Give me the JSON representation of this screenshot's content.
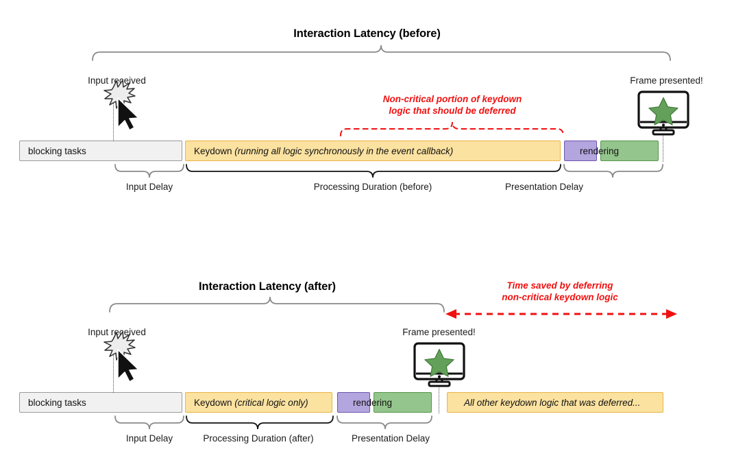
{
  "sections": [
    {
      "id": "before",
      "title": "Interaction Latency (before)",
      "input_label": "Input received",
      "frame_label": "Frame presented!",
      "annotation": {
        "line1": "Non-critical portion of keydown",
        "line2": "logic that should be deferred"
      },
      "bars": [
        {
          "name": "blocking-tasks",
          "label": "blocking tasks",
          "label_italic": ""
        },
        {
          "name": "keydown",
          "label": "Keydown ",
          "label_italic": "(running all logic synchronously in the event callback)"
        },
        {
          "name": "purple-render",
          "label": "",
          "label_italic": ""
        },
        {
          "name": "green-render",
          "label": "",
          "label_italic": ""
        }
      ],
      "rendering_label": "rendering",
      "braces": [
        {
          "name": "input-delay",
          "label": "Input Delay"
        },
        {
          "name": "processing-duration",
          "label": "Processing Duration (before)"
        },
        {
          "name": "presentation-delay",
          "label": "Presentation Delay"
        }
      ]
    },
    {
      "id": "after",
      "title": "Interaction Latency (after)",
      "input_label": "Input received",
      "frame_label": "Frame presented!",
      "annotation": {
        "line1": "Time saved by deferring",
        "line2": "non-critical keydown logic"
      },
      "bars": [
        {
          "name": "blocking-tasks",
          "label": "blocking tasks",
          "label_italic": ""
        },
        {
          "name": "keydown",
          "label": "Keydown ",
          "label_italic": "(critical logic only)"
        },
        {
          "name": "purple-render",
          "label": "",
          "label_italic": ""
        },
        {
          "name": "green-render",
          "label": "",
          "label_italic": ""
        },
        {
          "name": "deferred-work",
          "label": "",
          "label_italic": "All other keydown logic that was deferred..."
        }
      ],
      "rendering_label": "rendering",
      "braces": [
        {
          "name": "input-delay",
          "label": "Input Delay"
        },
        {
          "name": "processing-duration",
          "label": "Processing Duration (after)"
        },
        {
          "name": "presentation-delay",
          "label": "Presentation Delay"
        }
      ]
    }
  ],
  "colors": {
    "blocking_fill": "#f1f1f1",
    "blocking_stroke": "#9a9a9a",
    "keydown_fill": "#fbe2a0",
    "keydown_stroke": "#eab446",
    "render_purple_fill": "#b3a5dd",
    "render_purple_stroke": "#6c55b0",
    "render_green_fill": "#94c58c",
    "render_green_stroke": "#54964b",
    "annotation_red": "#f01010",
    "brace_gray": "#8a8a8a",
    "brace_black": "#111111",
    "star_green": "#63a05a"
  }
}
